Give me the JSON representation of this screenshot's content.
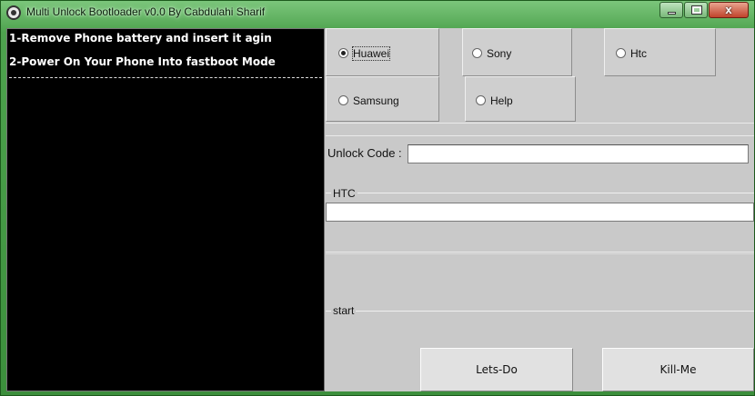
{
  "window": {
    "title": "Multi Unlock Bootloader v0.0  By Cabdulahi Sharif",
    "buttons": {
      "minimize": "",
      "maximize": "",
      "close": "x"
    }
  },
  "console": {
    "lines": [
      "1-Remove Phone battery and insert it agin",
      "2-Power On Your Phone Into fastboot Mode"
    ]
  },
  "brands": {
    "huawei": {
      "label": "Huawei",
      "checked": true
    },
    "sony": {
      "label": "Sony",
      "checked": false
    },
    "htc": {
      "label": "Htc",
      "checked": false
    },
    "samsung": {
      "label": "Samsung",
      "checked": false
    },
    "help": {
      "label": "Help",
      "checked": false
    }
  },
  "unlock": {
    "label": "Unlock Code :",
    "value": ""
  },
  "htc_group": {
    "label": "HTC",
    "value": ""
  },
  "start_group": {
    "label": "start"
  },
  "actions": {
    "lets_do": "Lets-Do",
    "kill_me": "Kill-Me"
  }
}
